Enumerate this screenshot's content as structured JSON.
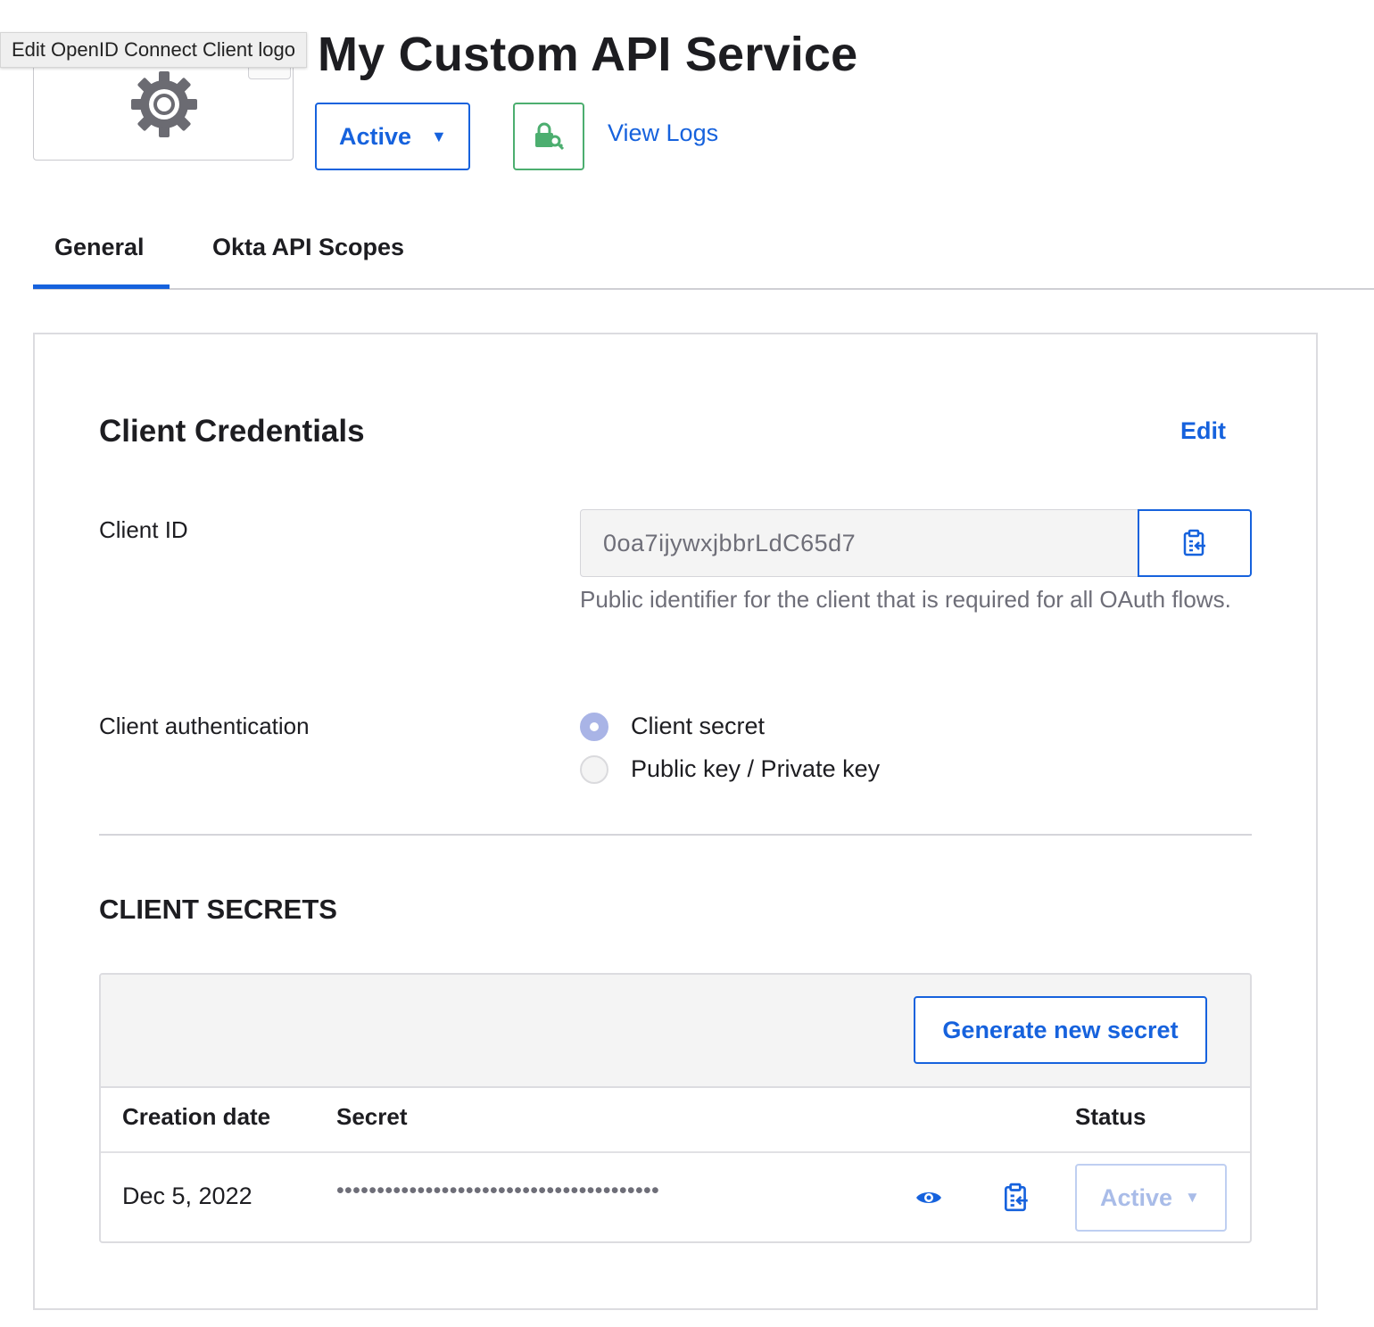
{
  "header": {
    "logo_tooltip": "Edit OpenID Connect Client logo",
    "logo_icon": "gear-icon",
    "title": "My Custom API Service",
    "status_label": "Active",
    "status_caret": "▼",
    "key_button_icon": "lock-key-icon",
    "view_logs_label": "View Logs"
  },
  "tabs": [
    {
      "label": "General",
      "active": true
    },
    {
      "label": "Okta API Scopes",
      "active": false
    }
  ],
  "client_credentials": {
    "title": "Client Credentials",
    "edit_label": "Edit",
    "client_id_label": "Client ID",
    "client_id_value": "0oa7ijywxjbbrLdC65d7",
    "client_id_help": "Public identifier for the client that is required for all OAuth flows.",
    "auth_label": "Client authentication",
    "auth_options": [
      {
        "label": "Client secret",
        "selected": true
      },
      {
        "label": "Public key / Private key",
        "selected": false
      }
    ]
  },
  "client_secrets": {
    "title": "CLIENT SECRETS",
    "generate_label": "Generate new secret",
    "columns": [
      "Creation date",
      "Secret",
      "Status"
    ],
    "rows": [
      {
        "creation_date": "Dec 5, 2022",
        "secret": "••••••••••••••••••••••••••••••••••••••••",
        "status": "Active",
        "status_caret": "▼"
      }
    ]
  },
  "colors": {
    "accent": "#1662dd",
    "success": "#4cae6f",
    "radio_selected": "#a9b4e6",
    "disabled_text": "#a9bce8"
  }
}
